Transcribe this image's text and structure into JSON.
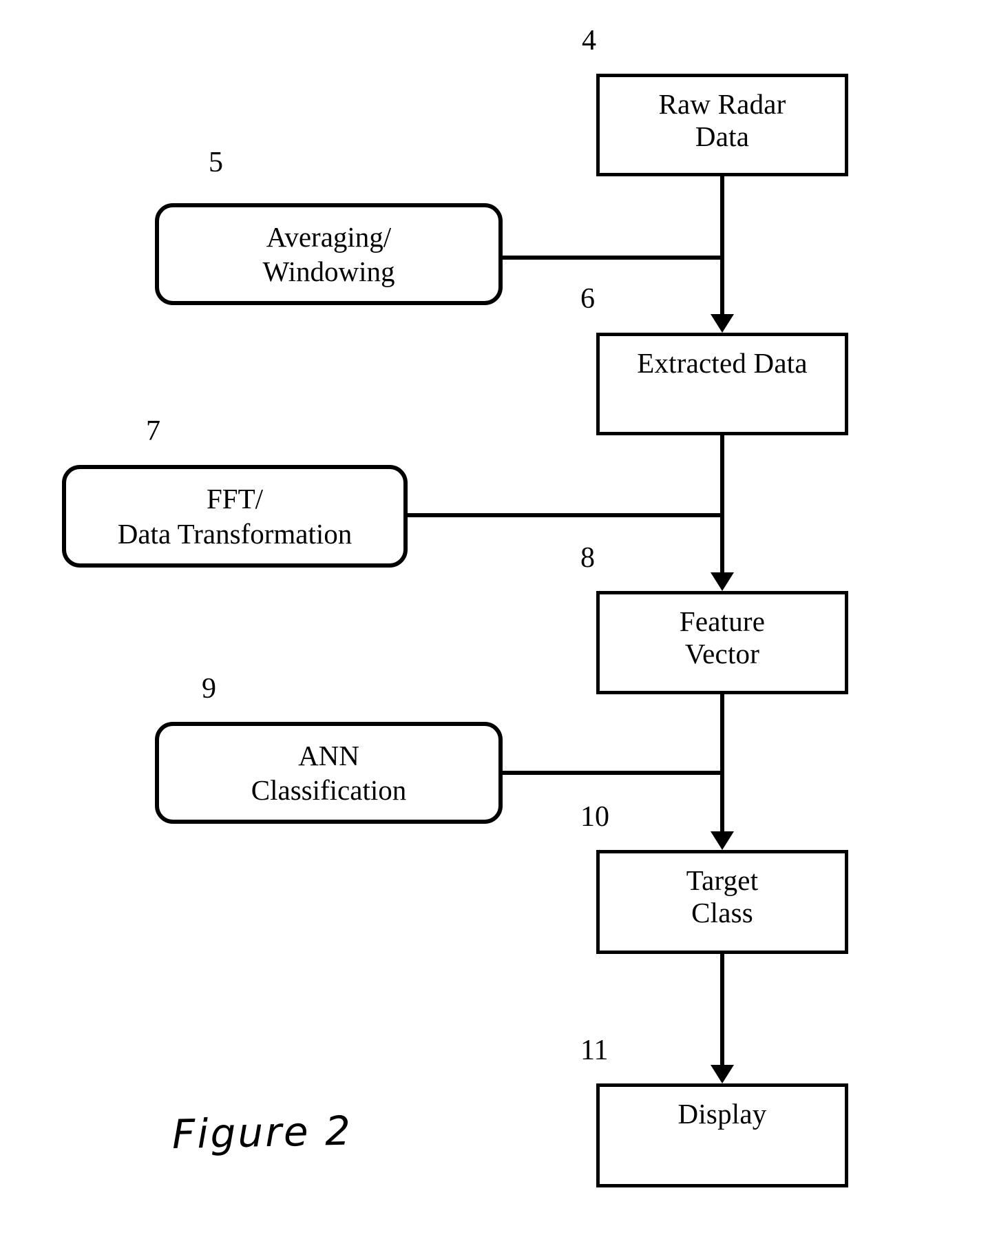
{
  "figure": {
    "caption": "Figure 2",
    "background_color": "#ffffff",
    "line_color": "#000000"
  },
  "process_boxes": [
    {
      "ref": "4",
      "name": "raw-radar-data",
      "lines": [
        "Raw Radar",
        "Data"
      ]
    },
    {
      "ref": "6",
      "name": "extracted-data",
      "lines": [
        "Extracted Data"
      ]
    },
    {
      "ref": "8",
      "name": "feature-vector",
      "lines": [
        "Feature",
        "Vector"
      ]
    },
    {
      "ref": "10",
      "name": "target-class",
      "lines": [
        "Target",
        "Class"
      ]
    },
    {
      "ref": "11",
      "name": "display",
      "lines": [
        "Display"
      ]
    }
  ],
  "operation_boxes": [
    {
      "ref": "5",
      "name": "averaging-windowing",
      "lines": [
        "Averaging/",
        "Windowing"
      ]
    },
    {
      "ref": "7",
      "name": "fft-data-transformation",
      "lines": [
        "FFT/",
        "Data Transformation"
      ]
    },
    {
      "ref": "9",
      "name": "ann-classification",
      "lines": [
        "ANN",
        "Classification"
      ]
    }
  ]
}
